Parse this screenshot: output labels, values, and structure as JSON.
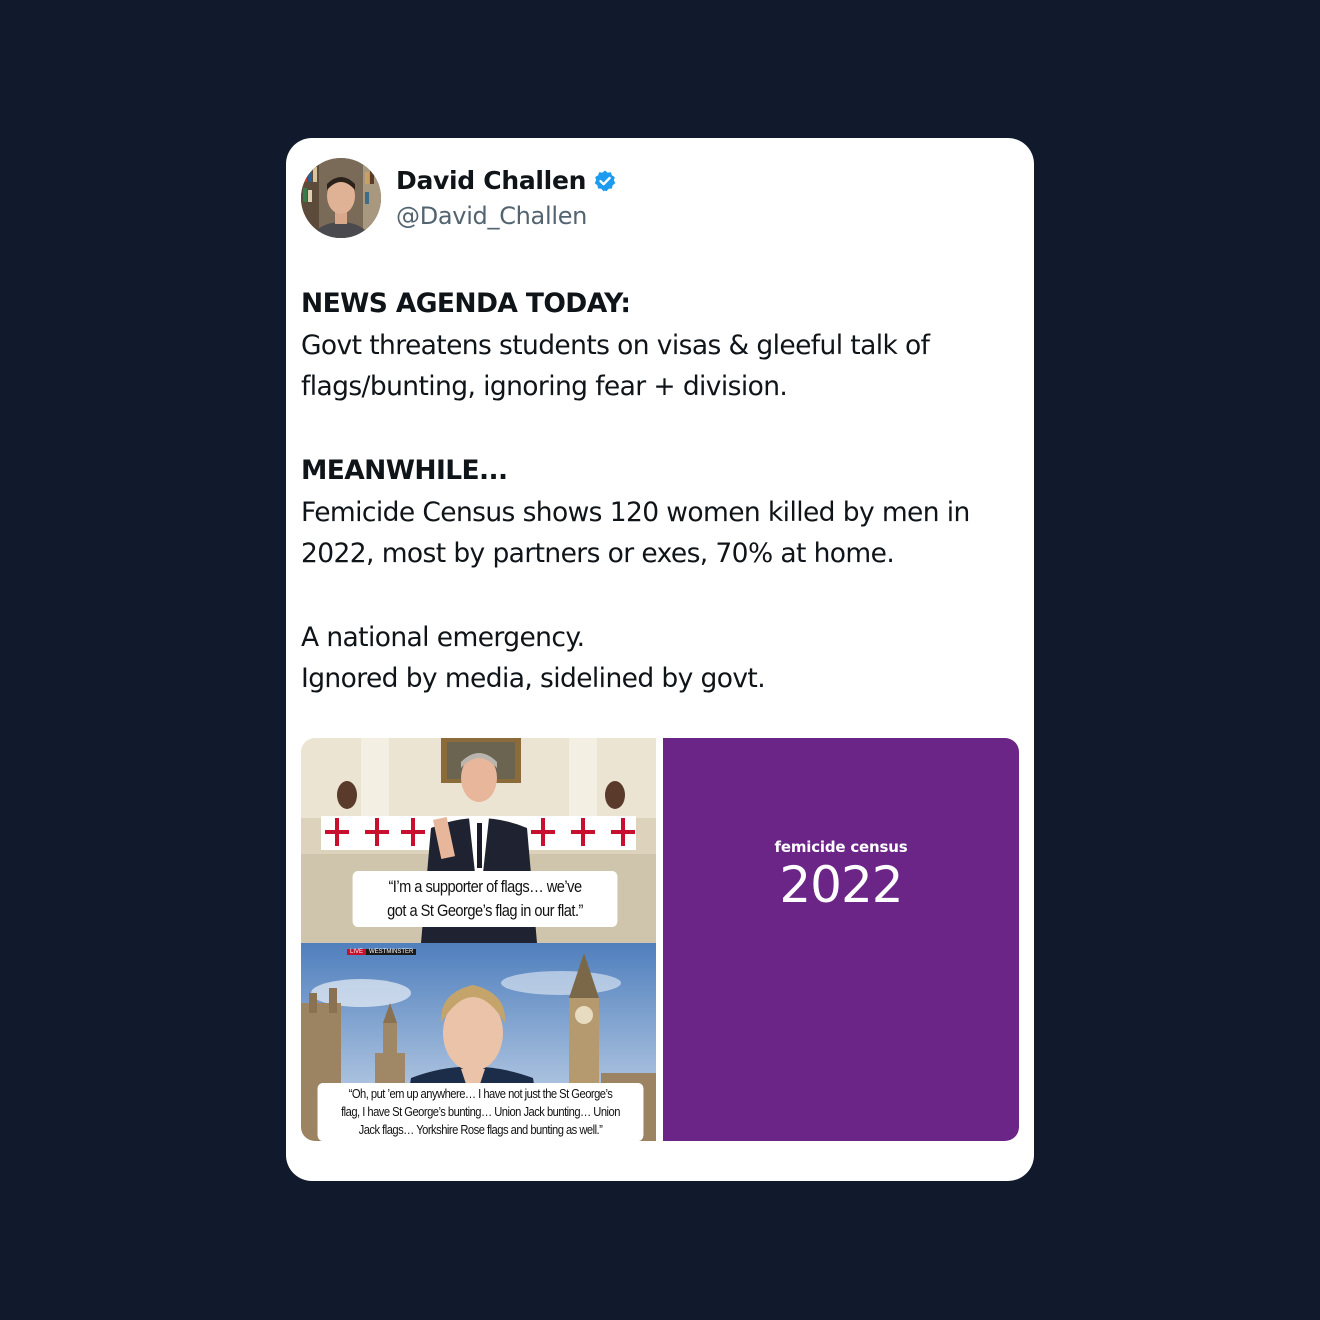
{
  "author": {
    "name": "David Challen",
    "handle": "@David_Challen",
    "verified": true
  },
  "tweet": {
    "heading1": "NEWS AGENDA TODAY:",
    "line1": "Govt threatens students on visas & gleeful talk of",
    "line2": "flags/bunting, ignoring fear + division.",
    "heading2": "MEANWHILE...",
    "line3": "Femicide Census shows 120 women killed by men in",
    "line4": "2022, most by partners or exes, 70% at home.",
    "line5": "A national emergency.",
    "line6": "Ignored by media, sidelined by govt."
  },
  "media": {
    "caption_top_1": "“I’m a supporter of flags… we’ve",
    "caption_top_2": "got a St George’s flag in our flat.”",
    "live_label": "LIVE",
    "live_location": "WESTMINSTER",
    "caption_bottom_1": "“Oh, put ’em up anywhere… I have not just the St George’s",
    "caption_bottom_2": "flag, I have St George’s bunting… Union Jack bunting… Union",
    "caption_bottom_3": "Jack flags… Yorkshire Rose flags and bunting as well.”",
    "fc_label": "femicide census",
    "fc_year": "2022"
  },
  "colors": {
    "background": "#111a2c",
    "verified_blue": "#1d9bf0",
    "census_purple": "#6b2587"
  },
  "icons": {
    "verified": "verified-badge-icon"
  }
}
